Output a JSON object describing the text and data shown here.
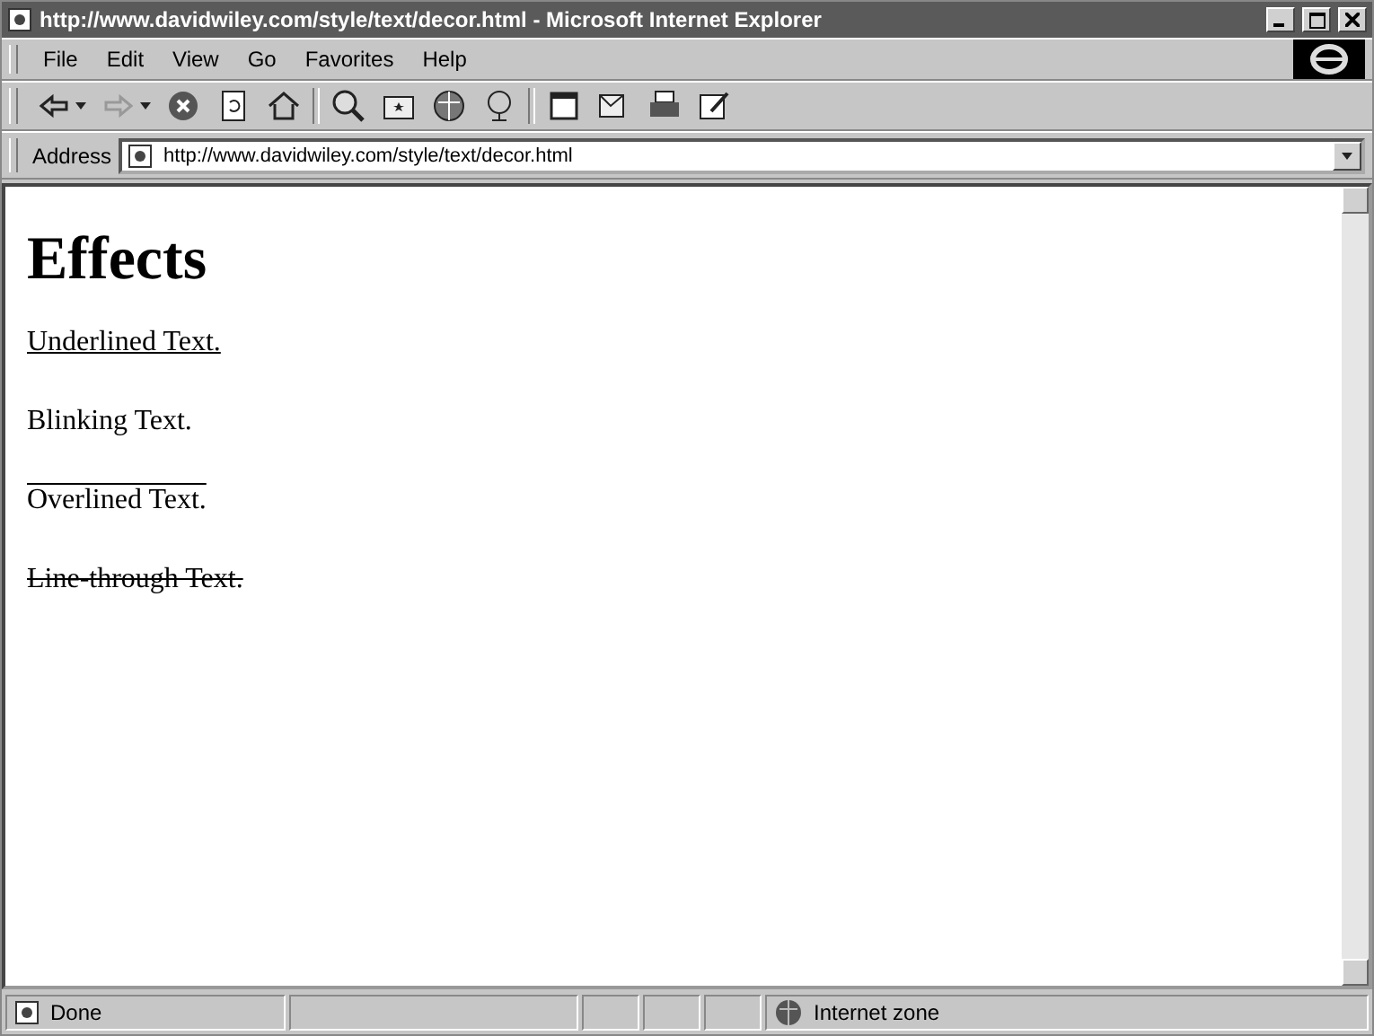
{
  "window": {
    "title": "http://www.davidwiley.com/style/text/decor.html - Microsoft Internet Explorer"
  },
  "menu": [
    "File",
    "Edit",
    "View",
    "Go",
    "Favorites",
    "Help"
  ],
  "toolbar": [
    {
      "kind": "back",
      "dropdown": true
    },
    {
      "kind": "forward",
      "dropdown": true,
      "disabled": true
    },
    {
      "kind": "stop"
    },
    {
      "kind": "refresh"
    },
    {
      "kind": "home"
    },
    {
      "kind": "sep"
    },
    {
      "kind": "search"
    },
    {
      "kind": "favorites"
    },
    {
      "kind": "history"
    },
    {
      "kind": "channels"
    },
    {
      "kind": "sep"
    },
    {
      "kind": "fullscreen"
    },
    {
      "kind": "mail"
    },
    {
      "kind": "print"
    },
    {
      "kind": "edit"
    }
  ],
  "address": {
    "label": "Address",
    "value": "http://www.davidwiley.com/style/text/decor.html"
  },
  "page": {
    "heading": "Effects",
    "lines": [
      {
        "text": "Underlined Text.",
        "kind": "underline"
      },
      {
        "text": "Blinking Text.",
        "kind": "blink"
      },
      {
        "text": "Overlined Text.",
        "kind": "overline"
      },
      {
        "text": "Line-through Text.",
        "kind": "strike"
      }
    ]
  },
  "status_bar": {
    "text": "Done",
    "zone": "Internet zone"
  }
}
